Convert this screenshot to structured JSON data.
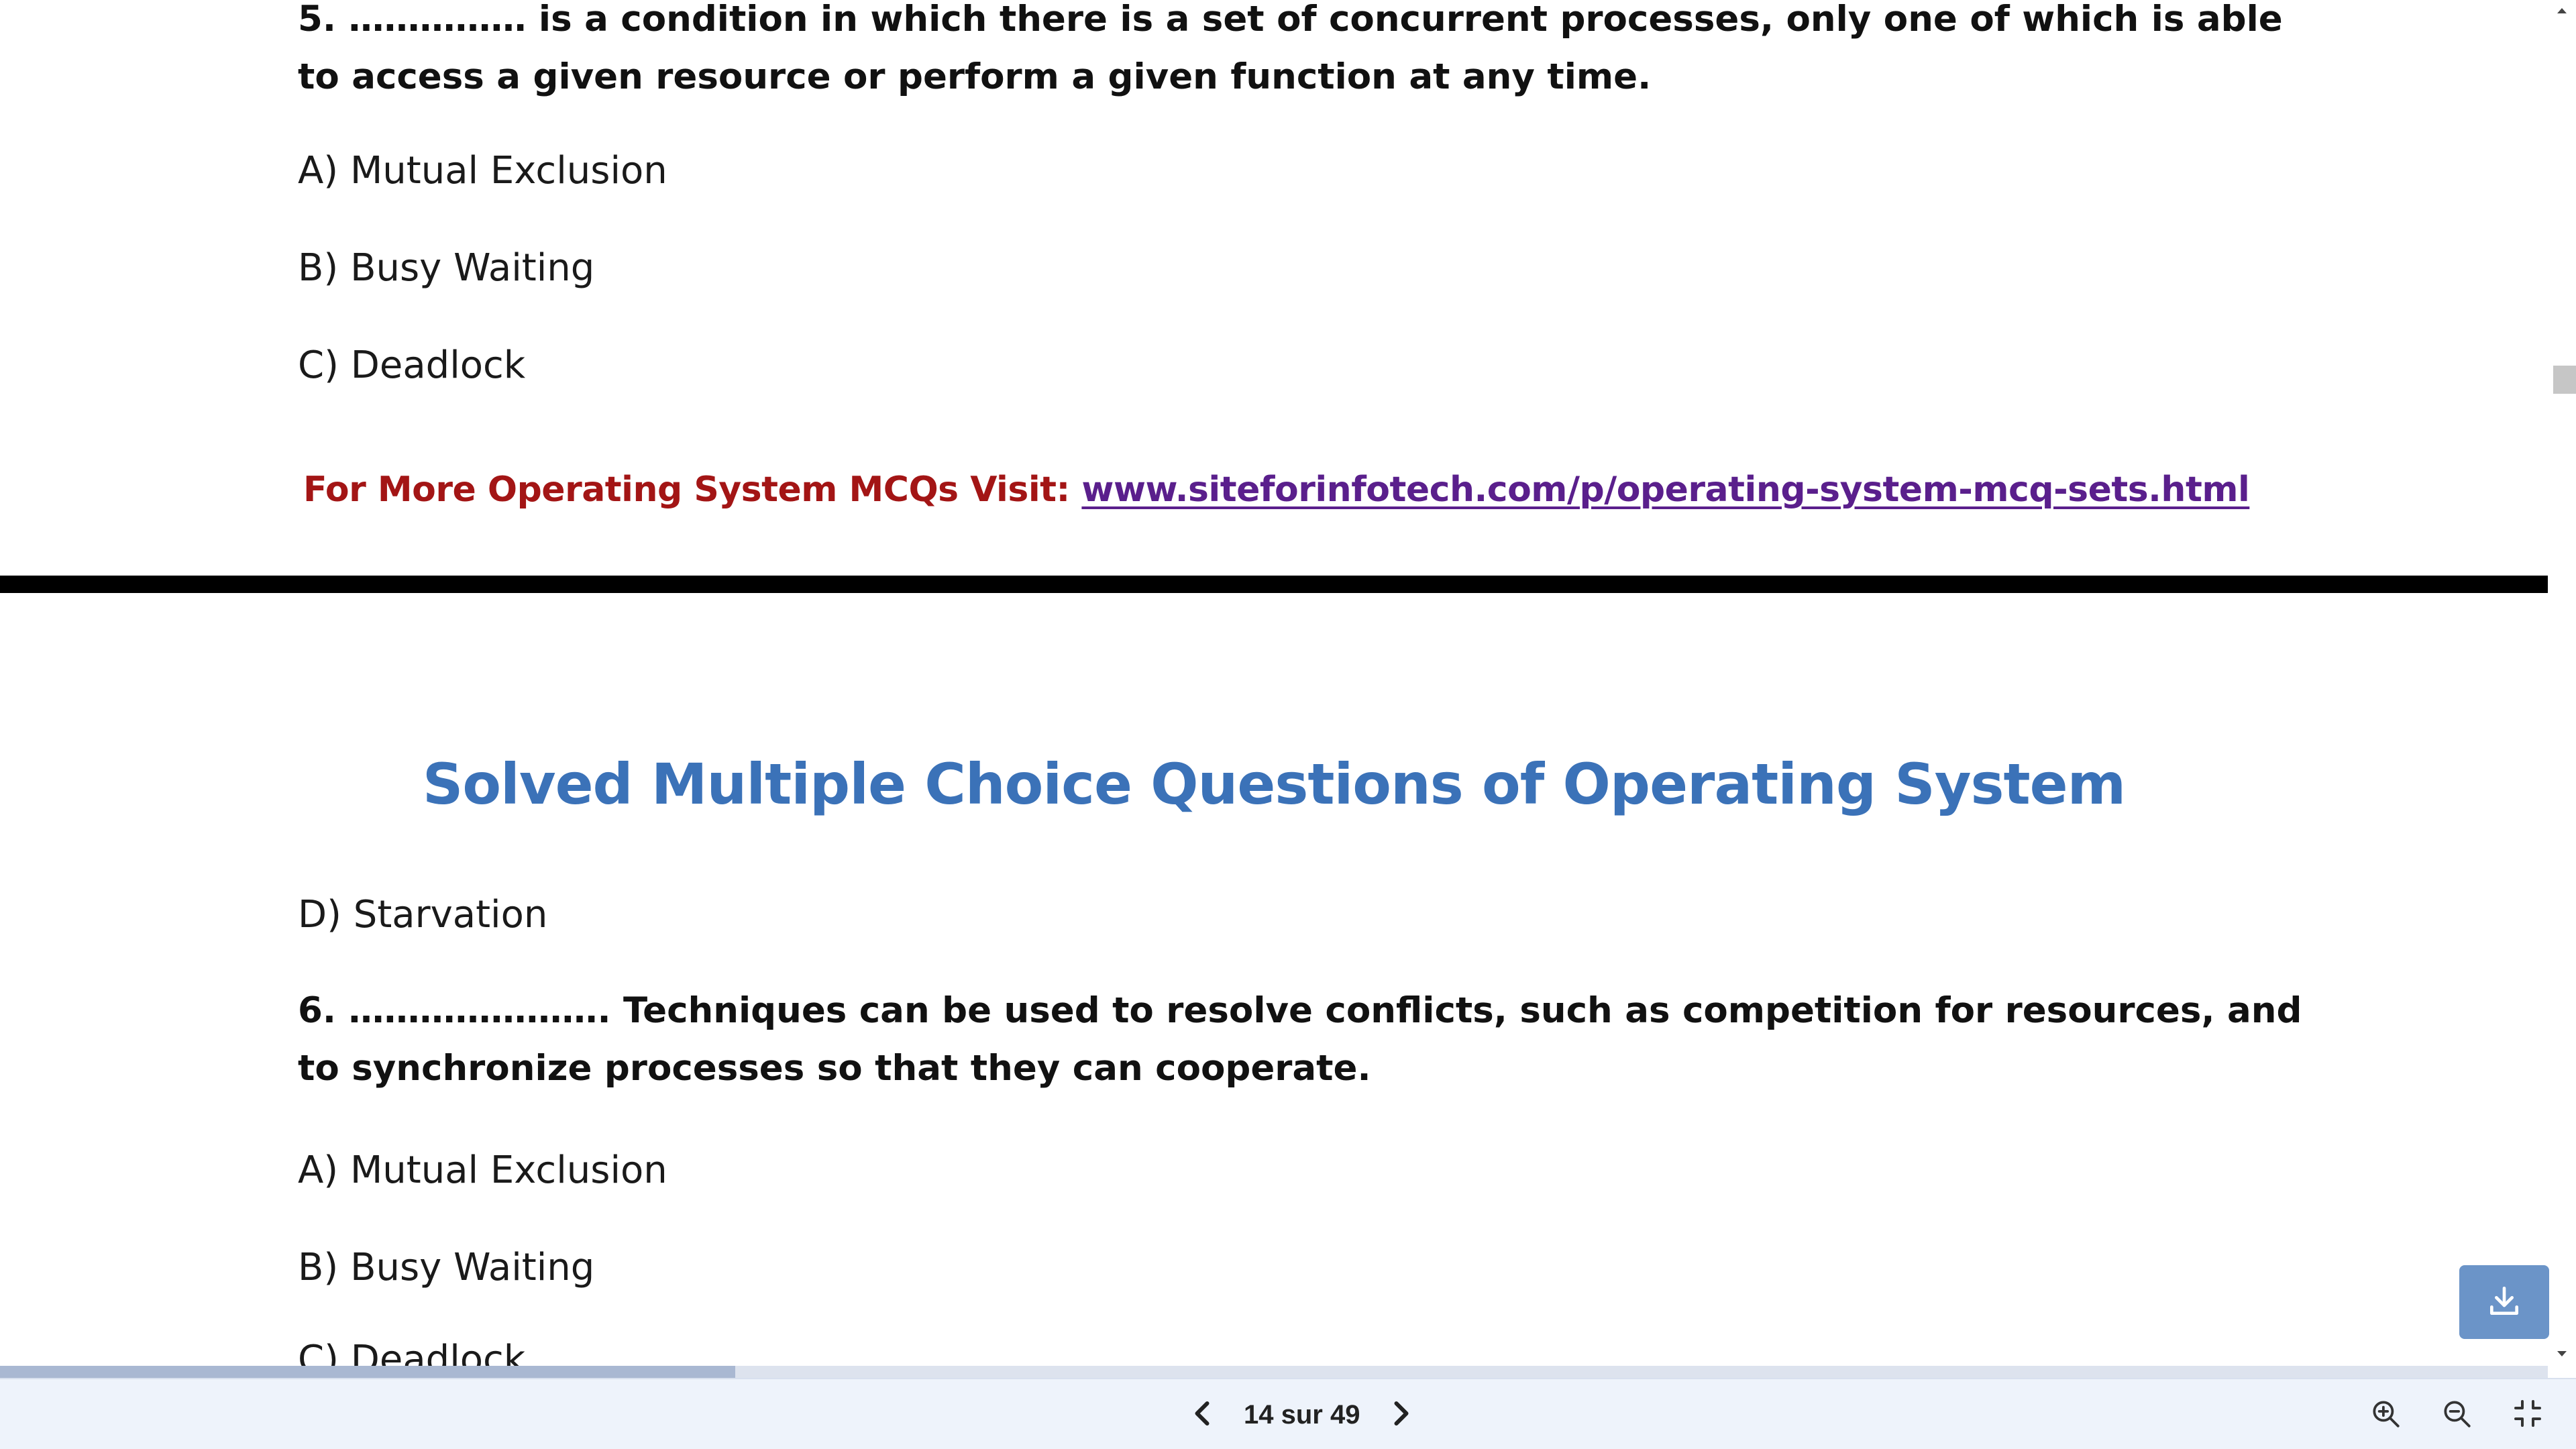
{
  "document": {
    "page_top": {
      "question5_text": "5. …………… is a condition in which there is a set of concurrent processes, only one of which is able to access a given resource or perform a given function at any time.",
      "options": [
        "A) Mutual Exclusion",
        "B) Busy Waiting",
        "C) Deadlock"
      ],
      "promo_label": "For More Operating System MCQs Visit: ",
      "promo_link": "www.siteforinfotech.com/p/operating-system-mcq-sets.html"
    },
    "page_bottom": {
      "title": "Solved Multiple Choice Questions of Operating System",
      "option_d": "D) Starvation",
      "question6_text": "6. …………………. Techniques can be used to resolve conflicts, such as competition for resources, and to synchronize processes so that they can cooperate.",
      "options": [
        "A) Mutual Exclusion",
        "B) Busy Waiting",
        "C) Deadlock"
      ]
    }
  },
  "toolbar": {
    "page_indicator": "14 sur 49",
    "prev_icon": "chevron-left-icon",
    "next_icon": "chevron-right-icon",
    "zoom_in_icon": "zoom-in-icon",
    "zoom_out_icon": "zoom-out-icon",
    "exit_fullscreen_icon": "exit-fullscreen-icon"
  },
  "download_icon": "download-icon",
  "colors": {
    "title_blue": "#3b72b8",
    "promo_red": "#a31515",
    "link_purple": "#5a1f8c",
    "download_button": "#6b94c8",
    "toolbar_bg": "#eef3fb"
  }
}
